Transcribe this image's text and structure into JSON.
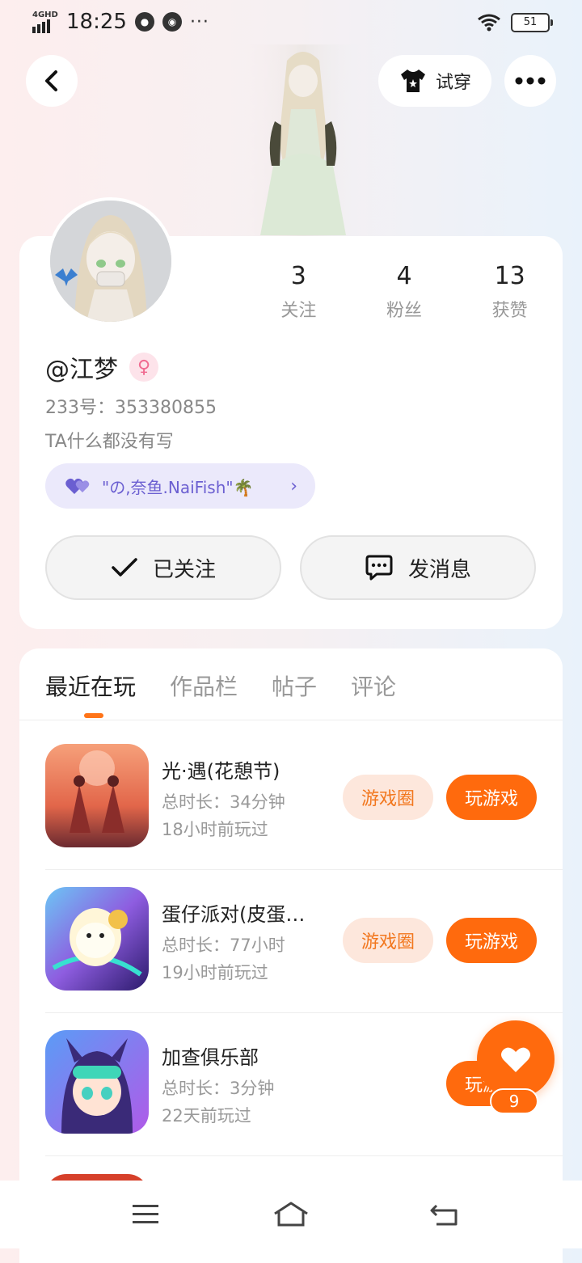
{
  "status_bar": {
    "network": "4GHD",
    "time": "18:25",
    "more": "···",
    "battery": "51"
  },
  "top_actions": {
    "try_on_label": "试穿"
  },
  "profile": {
    "stats": [
      {
        "value": "3",
        "label": "关注"
      },
      {
        "value": "4",
        "label": "粉丝"
      },
      {
        "value": "13",
        "label": "获赞"
      }
    ],
    "username": "@江梦",
    "user_id": "233号：353380855",
    "bio": "TA什么都没有写",
    "relation": "\"の,奈鱼.NaiFish\"🌴",
    "follow_label": "已关注",
    "message_label": "发消息"
  },
  "tabs": [
    "最近在玩",
    "作品栏",
    "帖子",
    "评论"
  ],
  "games": [
    {
      "name": "光·遇(花憩节)",
      "duration": "总时长：34分钟",
      "last_played": "18小时前玩过",
      "circle_label": "游戏圈",
      "play_label": "玩游戏"
    },
    {
      "name": "蛋仔派对(皮蛋…",
      "duration": "总时长：77小时",
      "last_played": "19小时前玩过",
      "circle_label": "游戏圈",
      "play_label": "玩游戏"
    },
    {
      "name": "加查俱乐部",
      "duration": "总时长：3分钟",
      "last_played": "22天前玩过",
      "play_label": "玩游戏"
    }
  ],
  "like": {
    "count": "9"
  },
  "colors": {
    "accent": "#ff6a0d",
    "accent_light": "#fde7dc",
    "relation": "#6b5fd1"
  }
}
